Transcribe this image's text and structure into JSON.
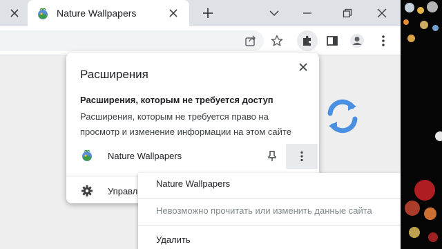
{
  "tabstrip": {
    "active_tab_title": "Nature Wallpapers"
  },
  "extensions_popup": {
    "title": "Расширения",
    "section_title": "Расширения, которым не требуется доступ",
    "section_description": "Расширения, которым не требуется право на просмотр и изменение информации на этом сайте",
    "extension_name": "Nature Wallpapers",
    "manage_label": "Управл"
  },
  "context_menu": {
    "items": [
      {
        "label": "Nature Wallpapers",
        "enabled": true
      },
      {
        "label": "Невозможно прочитать или изменить данные сайта",
        "enabled": false
      },
      {
        "label": "Удалить",
        "enabled": true
      }
    ]
  },
  "icons": {
    "tab_close": "close-icon",
    "favicon": "nature-wallpapers-icon",
    "new_tab": "plus-icon",
    "minimize": "chevron-down-icon",
    "restore": "restore-window-icon",
    "close_window": "close-icon",
    "share": "share-icon",
    "bookmark": "star-icon",
    "extensions": "puzzle-icon",
    "side_panel": "side-panel-icon",
    "profile": "profile-icon",
    "menu": "kebab-menu-icon",
    "pin": "pin-icon",
    "gear": "gear-icon",
    "refresh": "refresh-icon"
  },
  "colors": {
    "accent_blue": "#4a90e2",
    "tabstrip": "#dee1e6",
    "content_bg": "#eeeeee"
  }
}
